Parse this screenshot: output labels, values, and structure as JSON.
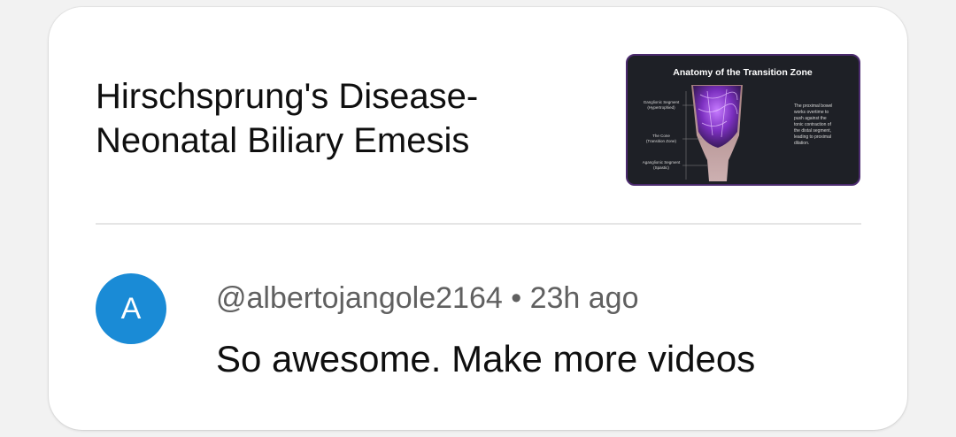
{
  "video": {
    "title": "Hirschsprung's Disease-Neonatal Biliary Emesis",
    "thumbnail": {
      "heading": "Anatomy of the Transition Zone",
      "label_top": "Ganglionic Segment",
      "label_top_sub": "(Hypertrophied)",
      "label_mid": "The Cone",
      "label_mid_sub": "(Transition Zone)",
      "label_bot": "Aganglionic Segment",
      "label_bot_sub": "(Spastic)",
      "note_lines": [
        "The proximal bowel",
        "works overtime to",
        "push against the",
        "tonic contraction of",
        "the distal segment,",
        "leading to proximal",
        "dilation."
      ]
    }
  },
  "comment": {
    "avatar_letter": "A",
    "author": "@albertojangole2164",
    "separator": "•",
    "time": "23h ago",
    "text": "So awesome. Make more videos"
  },
  "colors": {
    "avatar_bg": "#1a8bd6",
    "thumb_border": "#4b2a6e"
  }
}
